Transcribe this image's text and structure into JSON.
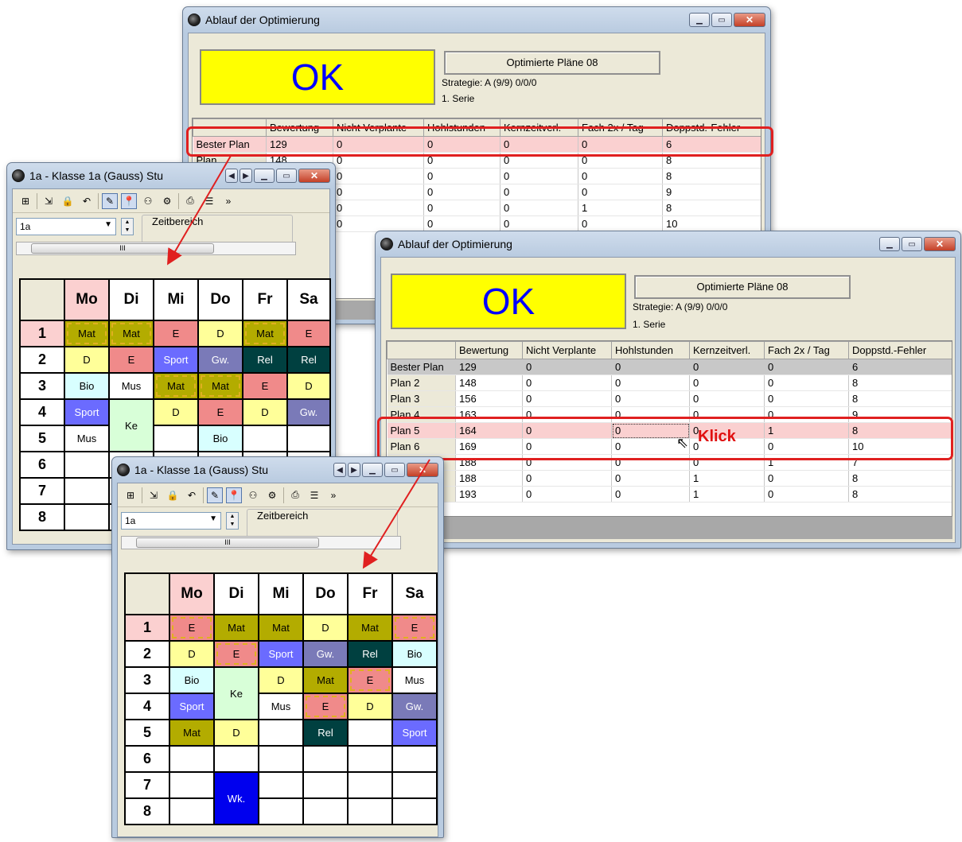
{
  "colors": {
    "ok_bg": "#ffff00",
    "ok_text": "#0000ff",
    "highlight_row": "#fad0d0",
    "arrow": "#e02020"
  },
  "win1": {
    "title": "Ablauf der Optimierung",
    "ok": "OK",
    "plans_button": "Optimierte Pläne 08",
    "strategy": "Strategie: A (9/9)  0/0/0",
    "series": "1. Serie",
    "columns": [
      "",
      "Bewertung",
      "Nicht Verplante",
      "Hohlstunden",
      "Kernzeitverl.",
      "Fach 2x / Tag",
      "Doppstd.-Fehler"
    ],
    "rows": [
      [
        "Bester Plan",
        "129",
        "0",
        "0",
        "0",
        "0",
        "6"
      ],
      [
        "Plan",
        "148",
        "0",
        "0",
        "0",
        "0",
        "8"
      ],
      [
        "",
        "",
        "0",
        "0",
        "0",
        "0",
        "8"
      ],
      [
        "",
        "",
        "0",
        "0",
        "0",
        "0",
        "9"
      ],
      [
        "",
        "",
        "0",
        "0",
        "0",
        "1",
        "8"
      ],
      [
        "",
        "",
        "0",
        "0",
        "0",
        "0",
        "10"
      ]
    ]
  },
  "win2": {
    "title": "Ablauf der Optimierung",
    "ok": "OK",
    "plans_button": "Optimierte Pläne 08",
    "strategy": "Strategie: A (9/9)  0/0/0",
    "series": "1. Serie",
    "columns": [
      "",
      "Bewertung",
      "Nicht Verplante",
      "Hohlstunden",
      "Kernzeitverl.",
      "Fach 2x / Tag",
      "Doppstd.-Fehler"
    ],
    "rows": [
      [
        "Bester Plan",
        "129",
        "0",
        "0",
        "0",
        "0",
        "6"
      ],
      [
        "Plan 2",
        "148",
        "0",
        "0",
        "0",
        "0",
        "8"
      ],
      [
        "Plan 3",
        "156",
        "0",
        "0",
        "0",
        "0",
        "8"
      ],
      [
        "Plan 4",
        "163",
        "0",
        "0",
        "0",
        "0",
        "9"
      ],
      [
        "Plan 5",
        "164",
        "0",
        "0",
        "0",
        "1",
        "8"
      ],
      [
        "Plan 6",
        "169",
        "0",
        "0",
        "0",
        "0",
        "10"
      ],
      [
        "",
        "188",
        "0",
        "0",
        "0",
        "1",
        "7"
      ],
      [
        "",
        "188",
        "0",
        "0",
        "1",
        "0",
        "8"
      ],
      [
        "",
        "193",
        "0",
        "0",
        "1",
        "0",
        "8"
      ]
    ],
    "klick": "Klick"
  },
  "tt1": {
    "title": "1a - Klasse 1a (Gauss)  Stu",
    "class_value": "1a",
    "zeitbereich": "Zeitbereich",
    "scroll_label": "III",
    "days": [
      "Mo",
      "Di",
      "Mi",
      "Do",
      "Fr",
      "Sa"
    ],
    "periods": [
      "1",
      "2",
      "3",
      "4",
      "5",
      "6",
      "7",
      "8"
    ],
    "cells": [
      [
        "Mat",
        "Mat",
        "E",
        "D",
        "Mat",
        "E"
      ],
      [
        "D",
        "E",
        "Sport",
        "Gw.",
        "Rel",
        "Rel"
      ],
      [
        "Bio",
        "Mus",
        "Mat",
        "Mat",
        "E",
        "D"
      ],
      [
        "Sport",
        "Ke",
        "D",
        "E",
        "D",
        "Gw."
      ],
      [
        "Mus",
        "",
        "",
        "Bio",
        "",
        ""
      ]
    ]
  },
  "tt2": {
    "title": "1a - Klasse 1a (Gauss)  Stu",
    "class_value": "1a",
    "zeitbereich": "Zeitbereich",
    "scroll_label": "III",
    "days": [
      "Mo",
      "Di",
      "Mi",
      "Do",
      "Fr",
      "Sa"
    ],
    "periods": [
      "1",
      "2",
      "3",
      "4",
      "5",
      "6",
      "7",
      "8"
    ],
    "cells": [
      [
        "E",
        "Mat",
        "Mat",
        "D",
        "Mat",
        "E"
      ],
      [
        "D",
        "E",
        "Sport",
        "Gw.",
        "Rel",
        "Bio"
      ],
      [
        "Bio",
        "Ke",
        "D",
        "Mat",
        "E",
        "Mus"
      ],
      [
        "Sport",
        "",
        "Mus",
        "E",
        "D",
        "Gw."
      ],
      [
        "Mat",
        "D",
        "",
        "Rel",
        "",
        "Sport"
      ],
      [
        "",
        "",
        "",
        "",
        "",
        ""
      ],
      [
        "",
        "Wk.",
        "",
        "",
        "",
        ""
      ]
    ]
  }
}
